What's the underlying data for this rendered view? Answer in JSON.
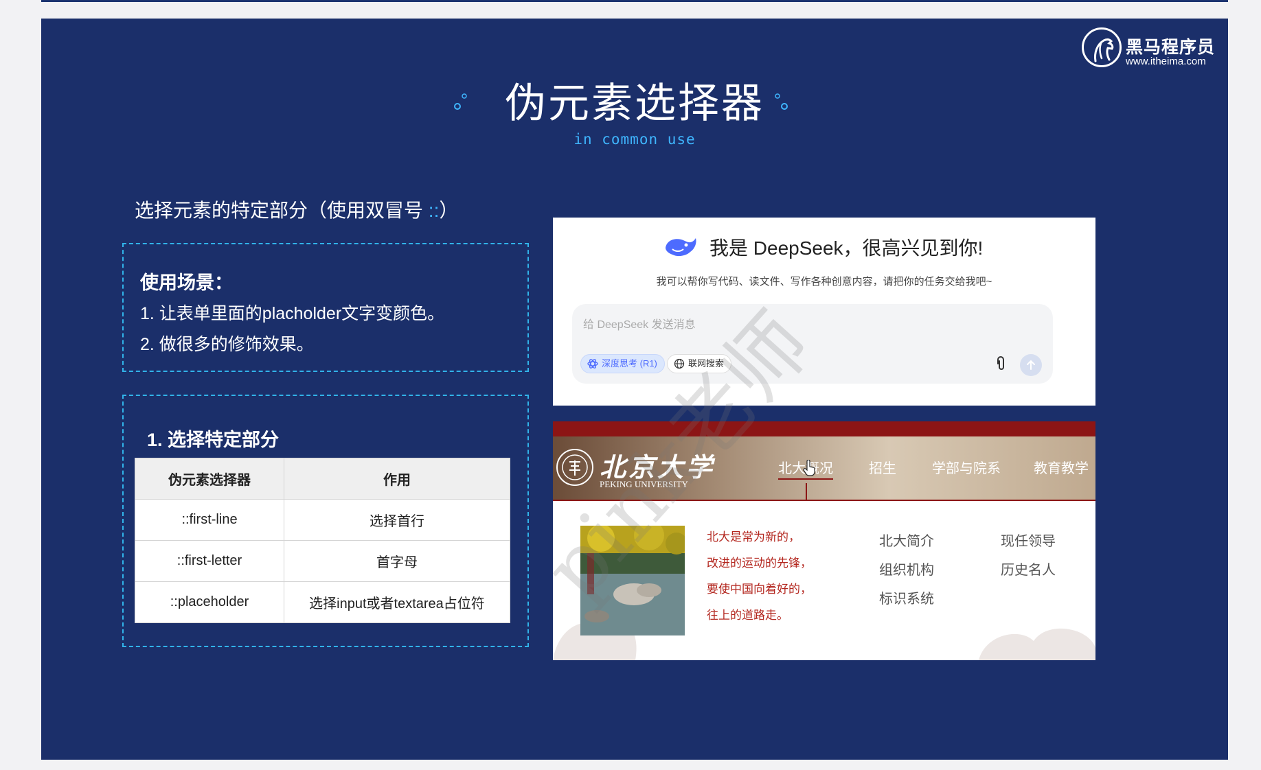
{
  "brand": {
    "name": "黑马程序员",
    "url": "www.itheima.com"
  },
  "header": {
    "title": "伪元素选择器",
    "subtitle": "in common use"
  },
  "intro": {
    "text": "选择元素的特定部分（使用双冒号",
    "colons": "::",
    "close": "）"
  },
  "scenario": {
    "heading": "使用场景：",
    "items": [
      "1. 让表单里面的placholder文字变颜色。",
      "2. 做很多的修饰效果。"
    ]
  },
  "selector_section": {
    "heading": "1. 选择特定部分",
    "columns": [
      "伪元素选择器",
      "作用"
    ],
    "rows": [
      [
        "::first-line",
        "选择首行"
      ],
      [
        "::first-letter",
        "首字母"
      ],
      [
        "::placeholder",
        "选择input或者textarea占位符"
      ]
    ]
  },
  "deepseek": {
    "title": "我是 DeepSeek，很高兴见到你!",
    "subtitle": "我可以帮你写代码、读文件、写作各种创意内容，请把你的任务交给我吧~",
    "placeholder": "给 DeepSeek 发送消息",
    "chip_deep": "深度思考 (R1)",
    "chip_web": "联网搜索",
    "accent": "#4d6bfe"
  },
  "pku": {
    "name_cn": "北京大学",
    "name_en": "PEKING UNIVERSITY",
    "nav": [
      "北大概况",
      "招生",
      "学部与院系",
      "教育教学"
    ],
    "quotes": [
      "北大是常为新的，",
      "改进的运动的先锋，",
      "要使中国向着好的，",
      "往上的道路走。"
    ],
    "links": [
      "北大简介",
      "组织机构",
      "标识系统",
      "现任领导",
      "历史名人"
    ],
    "accent": "#8c1515"
  },
  "watermark": "pink老师"
}
